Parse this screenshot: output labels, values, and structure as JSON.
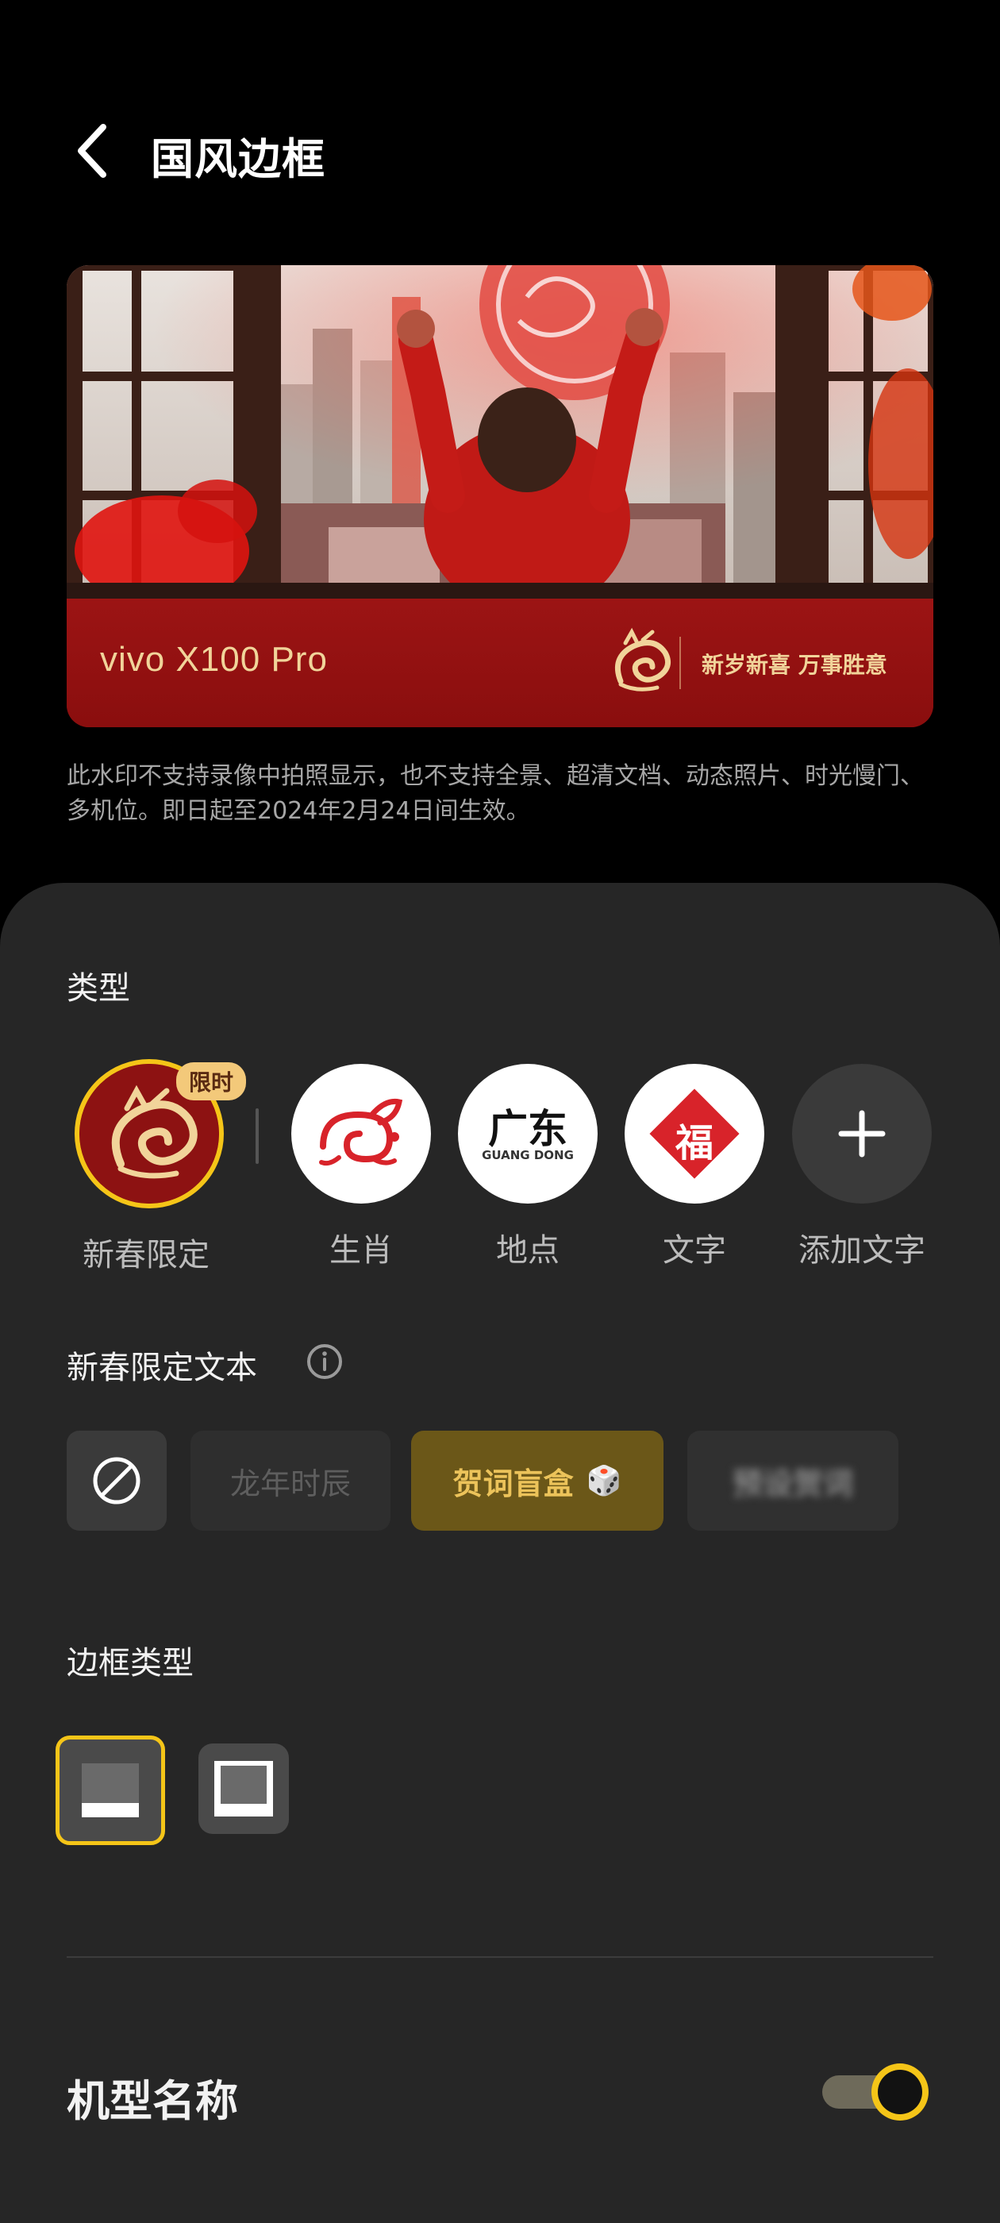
{
  "header": {
    "title": "国风边框"
  },
  "preview": {
    "model_text": "vivo X100 Pro",
    "slogan": "新岁新喜 万事胜意"
  },
  "notice": "此水印不支持录像中拍照显示，也不支持全景、超清文档、动态照片、时光慢门、多机位。即日起至2024年2月24日间生效。",
  "type_section": {
    "label": "类型",
    "badge": "限时",
    "items": [
      {
        "label": "新春限定",
        "icon": "dragon-icon",
        "selected": true
      },
      {
        "label": "生肖",
        "icon": "rabbit-icon"
      },
      {
        "label": "地点",
        "icon": "guangdong-icon",
        "logo_text": "广东",
        "logo_subtext": "GUANG DONG"
      },
      {
        "label": "文字",
        "icon": "fu-icon",
        "glyph": "福"
      },
      {
        "label": "添加文字",
        "icon": "plus-icon"
      }
    ]
  },
  "text_section": {
    "label": "新春限定文本",
    "options": [
      {
        "label": "",
        "icon": "none-icon"
      },
      {
        "label": "龙年时辰"
      },
      {
        "label": "贺词盲盒",
        "icon": "dice-icon",
        "icon_glyph": "🎲",
        "selected": true
      },
      {
        "label": "预设贺词"
      }
    ]
  },
  "border_section": {
    "label": "边框类型",
    "selected_index": 0
  },
  "model_name": {
    "label": "机型名称",
    "enabled": true
  },
  "colors": {
    "accent": "#f5c518",
    "frame_red": "#8f0f0f",
    "gold": "#f1d49a"
  }
}
